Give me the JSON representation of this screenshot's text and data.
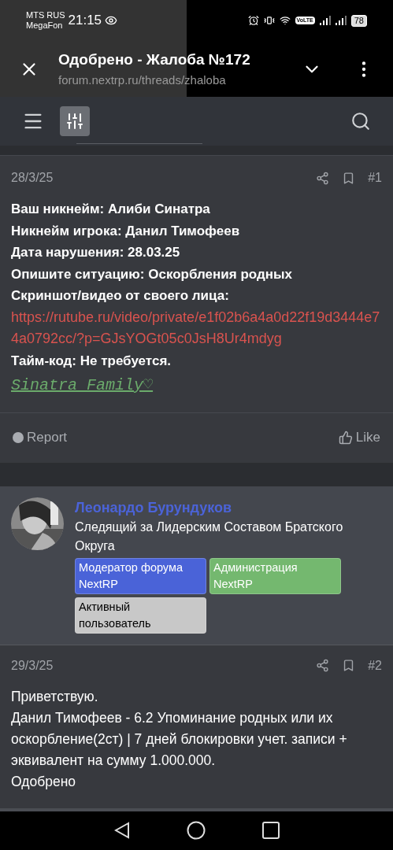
{
  "status_bar": {
    "carrier_1": "MTS RUS",
    "carrier_2": "MegaFon",
    "time": "21:15",
    "volte": "VoLTE",
    "battery": "78"
  },
  "browser": {
    "title": "Одобрено - Жалоба №172",
    "url": "forum.nextrp.ru/threads/zhaloba"
  },
  "posts": [
    {
      "date": "28/3/25",
      "number": "#1",
      "lines": [
        {
          "kind": "text",
          "text": "Ваш никнейм: Алиби Синатра"
        },
        {
          "kind": "text",
          "text": "Никнейм игрока: Данил Тимофеев"
        },
        {
          "kind": "text",
          "text": "Дата нарушения: 28.03.25"
        },
        {
          "kind": "text",
          "text": "Опишите ситуацию: Оскорбления родных"
        },
        {
          "kind": "text",
          "text": "Скриншот/видео от своего лица:"
        },
        {
          "kind": "link",
          "text": "https://rutube.ru/video/private/e1f02b6a4a0d22f19d3444e74a0792cc/?p=GJsYOGt05c0JsH8Ur4mdyg"
        },
        {
          "kind": "text",
          "text": "Тайм-код: Не требуется."
        },
        {
          "kind": "signature",
          "text": "Sinatra Family♡"
        }
      ],
      "report": "Report",
      "like": "Like"
    },
    {
      "author": {
        "name": "Леонардо Бурундуков",
        "title": "Следящий за Лидерским Составом Братского Округа",
        "badges": [
          {
            "text": "Модератор форума NextRP",
            "color": "#4a63d8"
          },
          {
            "text": "Администрация NextRP",
            "color": "#74b86f"
          },
          {
            "text": "Активный пользователь",
            "color": "#c8c8c8"
          }
        ]
      },
      "date": "29/3/25",
      "number": "#2",
      "lines": [
        {
          "kind": "plain",
          "text": "Приветствую."
        },
        {
          "kind": "plain",
          "text": "Данил Тимофеев - 6.2 Упоминание родных или их оскорбление(2ст) | 7 дней блокировки учет. записи + эквивалент на сумму 1.000.000."
        },
        {
          "kind": "plain",
          "text": "Одобрено"
        }
      ]
    }
  ]
}
